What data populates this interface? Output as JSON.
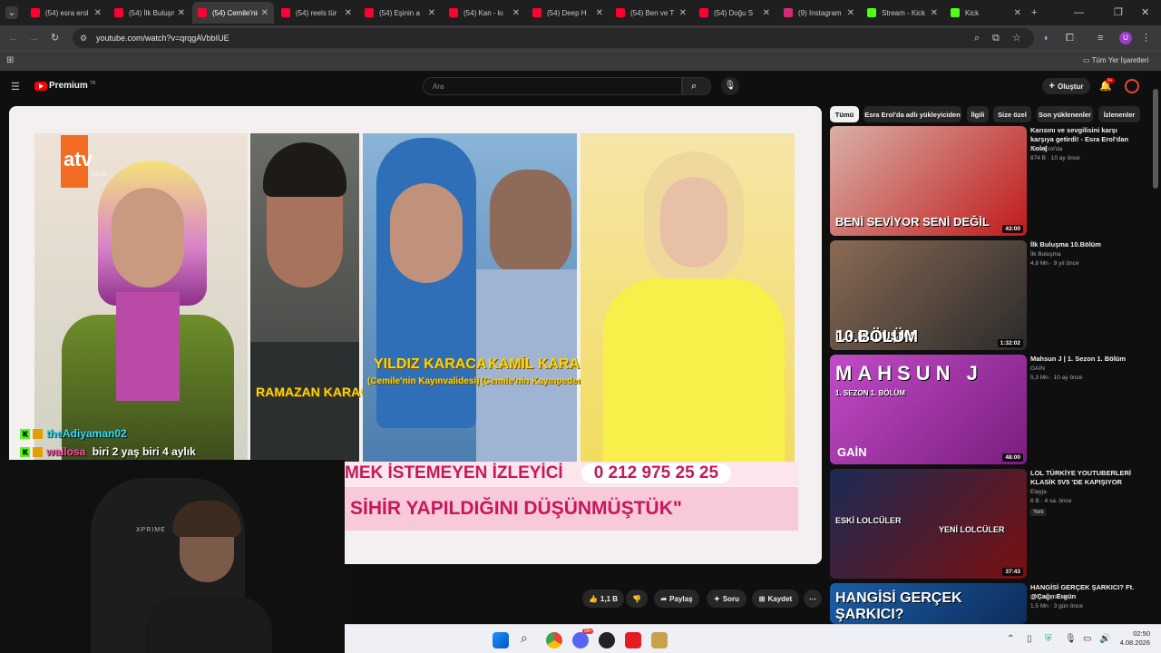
{
  "browser": {
    "tabs": [
      {
        "title": "(54) esra erol",
        "icon": "youtube-icon",
        "active": false
      },
      {
        "title": "(54) İlk Buluşma",
        "icon": "youtube-icon",
        "active": false
      },
      {
        "title": "(54) Cemile'nin",
        "icon": "youtube-icon",
        "active": true
      },
      {
        "title": "(54) reels tür",
        "icon": "youtube-icon",
        "active": false
      },
      {
        "title": "(54) Eşinin a",
        "icon": "youtube-icon",
        "active": false
      },
      {
        "title": "(54) Kan - kı",
        "icon": "youtube-icon",
        "active": false
      },
      {
        "title": "(54) Deep H",
        "icon": "youtube-icon",
        "active": false
      },
      {
        "title": "(54) Ben ve T",
        "icon": "youtube-icon",
        "active": false
      },
      {
        "title": "(54) Doğu S",
        "icon": "youtube-icon",
        "active": false
      },
      {
        "title": "(9) Instagram",
        "icon": "instagram-icon",
        "active": false
      },
      {
        "title": "Stream - Kick",
        "icon": "kick-icon",
        "active": false
      },
      {
        "title": "Kick",
        "icon": "kick-icon",
        "active": false
      }
    ],
    "new_tab": "+",
    "url": "youtube.com/watch?v=qrqgAVbbIUE",
    "bookmarks_all": "Tüm Yer İşaretleri",
    "profile_letter": "U"
  },
  "youtube": {
    "logo_text": "Premium",
    "logo_sup": "TR",
    "search_placeholder": "Ara",
    "create_label": "Oluştur",
    "notif_count": "9+",
    "chips": [
      "Tümü",
      "Esra Erol'da adlı yükleyiciden",
      "İlgili",
      "Size özel",
      "Son yüklenenler",
      "İzlenenler"
    ],
    "video": {
      "channel_logo": "atv",
      "channel_sub": "canlı",
      "name1": "RAMAZAN KARACA",
      "name2": "YILDIZ KARACA",
      "name2_sub": "(Cemile'nin Kayınvalidesi)",
      "name3": "KAMİL KARACA",
      "name3_sub": "(Cemile'nin Kayınpederi)",
      "banner_left": "MEK İSTEMEYEN İZLEYİCİ",
      "banner_phone": "0 212 975 25 25",
      "banner_quote": "SİHİR YAPILDIĞINI DÜŞÜNMÜŞTÜK\""
    },
    "actions": {
      "likes": "1,1 B",
      "share": "Paylaş",
      "ask": "Soru",
      "save": "Kaydet",
      "more": "⋯"
    },
    "recommendations": [
      {
        "title": "Karısını ve sevgilisini karşı karşıya getirdi! - Esra Erol'dan Kolaj",
        "channel": "Esra Erol'da",
        "meta": "874 B · 10 ay önce",
        "duration": "43:00",
        "overlay": "BENİ SEVİYOR SENİ DEĞİL",
        "colors": [
          "#d8b0a8",
          "#c01a1a"
        ]
      },
      {
        "title": "İlk Buluşma 10.Bölüm",
        "channel": "İlk Buluşma",
        "meta": "4,8 Mn · 9 yıl önce",
        "duration": "1:32:02",
        "overlay": "İLK BULUŞMA",
        "overlay2": "10.BÖLÜM",
        "colors": [
          "#8a6a55",
          "#2a2a2a"
        ]
      },
      {
        "title": "Mahsun J | 1. Sezon 1. Bölüm",
        "channel": "GAİN",
        "meta": "5,3 Mn · 10 ay önce",
        "duration": "48:00",
        "overlay": "MAHSUN J",
        "overlay2": "1. SEZON 1. BÖLÜM",
        "brand": "GAİN",
        "colors": [
          "#c14bc8",
          "#7a1d7e"
        ]
      },
      {
        "title": "LOL TÜRKİYE YOUTUBERLERİ KLASİK 5V5 'DE KAPIŞIYOR",
        "channel": "Elayja",
        "meta": "6 B · 4 sa. önce",
        "badge": "Yeni",
        "duration": "37:43",
        "overlay": "ESKİ LOLCÜLER",
        "overlay2": "YENİ LOLCÜLER",
        "colors": [
          "#1b2a55",
          "#7a1010"
        ]
      },
      {
        "title": "HANGİSİ GERÇEK ŞARKICI? Ft. @Çağrı Ergün",
        "channel": "Orkun Işıtmak",
        "meta": "1,5 Mn · 3 gün önce",
        "overlay": "HANGİSİ GERÇEK ŞARKICI?",
        "colors": [
          "#1b5ea8",
          "#0c2d5c"
        ]
      }
    ]
  },
  "stream_overlay": {
    "chat": [
      {
        "user": "theAdiyaman02",
        "color": "#2fe0ff",
        "message": ""
      },
      {
        "user": "wallosa",
        "color": "#ff4d9e",
        "message": "biri 2 yaş biri 4 aylık"
      }
    ],
    "chair_brand": "XPRIME"
  },
  "taskbar": {
    "time": "02:50",
    "date": "4.08.2026",
    "badge": "99+"
  }
}
